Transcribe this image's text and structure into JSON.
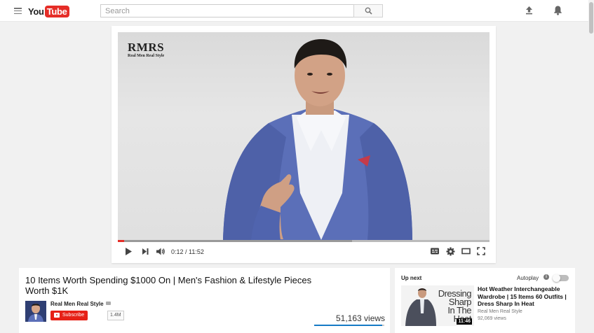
{
  "header": {
    "logo_you": "You",
    "logo_tube": "Tube",
    "search_placeholder": "Search"
  },
  "player": {
    "channel_mark": "RMRS",
    "channel_mark_sub": "Real Men Real Style",
    "time": "0:12 / 11:52",
    "played_fraction": 0.017,
    "buffered_fraction": 0.63
  },
  "video": {
    "title": "10 Items Worth Spending $1000 On | Men's Fashion & Lifestyle Pieces Worth $1K",
    "channel": "Real Men Real Style",
    "subscribe_label": "Subscribe",
    "subscriber_count": "1.4M",
    "views": "51,163 views",
    "like_fraction": 0.97
  },
  "sidebar": {
    "up_next_label": "Up next",
    "autoplay_label": "Autoplay",
    "autoplay_on": false,
    "item": {
      "title": "Hot Weather Interchangeable Wardrobe | 15 Items 60 Outfits | Dress Sharp In Heat",
      "channel": "Real Men Real Style",
      "views": "92,069 views",
      "duration": "11:46",
      "thumb_text": [
        "Dressing",
        "Sharp",
        "In The",
        "Heat"
      ]
    }
  },
  "colors": {
    "brand_red": "#e52d27",
    "subscribe_red": "#e62117",
    "like_blue": "#167ac6"
  }
}
